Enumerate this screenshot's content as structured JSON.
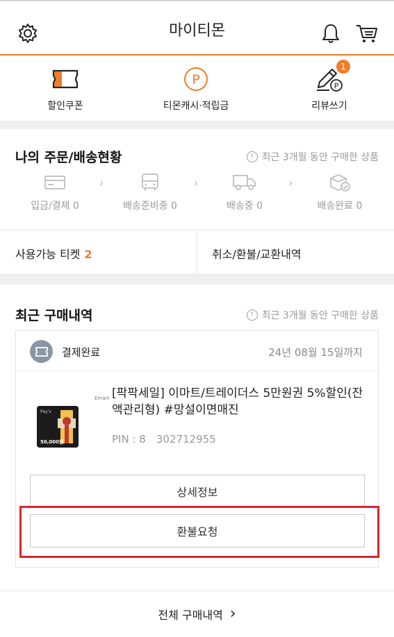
{
  "header": {
    "title": "마이티몬",
    "settings_icon": "gear-icon",
    "notification_icon": "bell-icon",
    "cart_icon": "cart-icon"
  },
  "quick_menu": [
    {
      "label": "할인쿠폰",
      "icon": "coupon-icon"
    },
    {
      "label": "티몬캐시·적립금",
      "icon": "points-icon",
      "icon_text": "P"
    },
    {
      "label": "리뷰쓰기",
      "icon": "pencil-icon",
      "badge": "1",
      "icon_text": "P"
    }
  ],
  "orders": {
    "title": "나의 주문/배송현황",
    "note": "최근 3개월 동안 구매한 상품",
    "info_symbol": "!",
    "steps": [
      {
        "label": "입금/결제",
        "count": "0",
        "icon": "card-icon"
      },
      {
        "label": "배송준비중",
        "count": "0",
        "icon": "bus-icon"
      },
      {
        "label": "배송중",
        "count": "0",
        "icon": "truck-icon"
      },
      {
        "label": "배송완료",
        "count": "0",
        "icon": "box-check-icon"
      }
    ],
    "chevron": "›"
  },
  "tickets": {
    "label": "사용가능 티켓",
    "count": "2",
    "refund_history": "취소/환불/교환내역"
  },
  "recent": {
    "title": "최근 구매내역",
    "note": "최근 3개월 동안 구매한 상품",
    "info_symbol": "!",
    "status": "결제완료",
    "date": "24년 08월 15일까지",
    "product_name": "[팍팍세일] 이마트/트레이더스 5만원권 5%할인(잔액관리형) #망설이면매진",
    "pin": "PIN : 8 302712955",
    "thumb": {
      "brand": "Emart",
      "label": "Pay'v",
      "amount": "50,000원"
    },
    "detail_button": "상세정보",
    "refund_button": "환불요청",
    "all_purchases": "전체 구매내역",
    "all_chevron": "›",
    "highlight_color": "#d9252f"
  },
  "colors": {
    "accent": "#f07c2a",
    "muted": "#9a9a9a",
    "section_gap": "#efefef"
  }
}
